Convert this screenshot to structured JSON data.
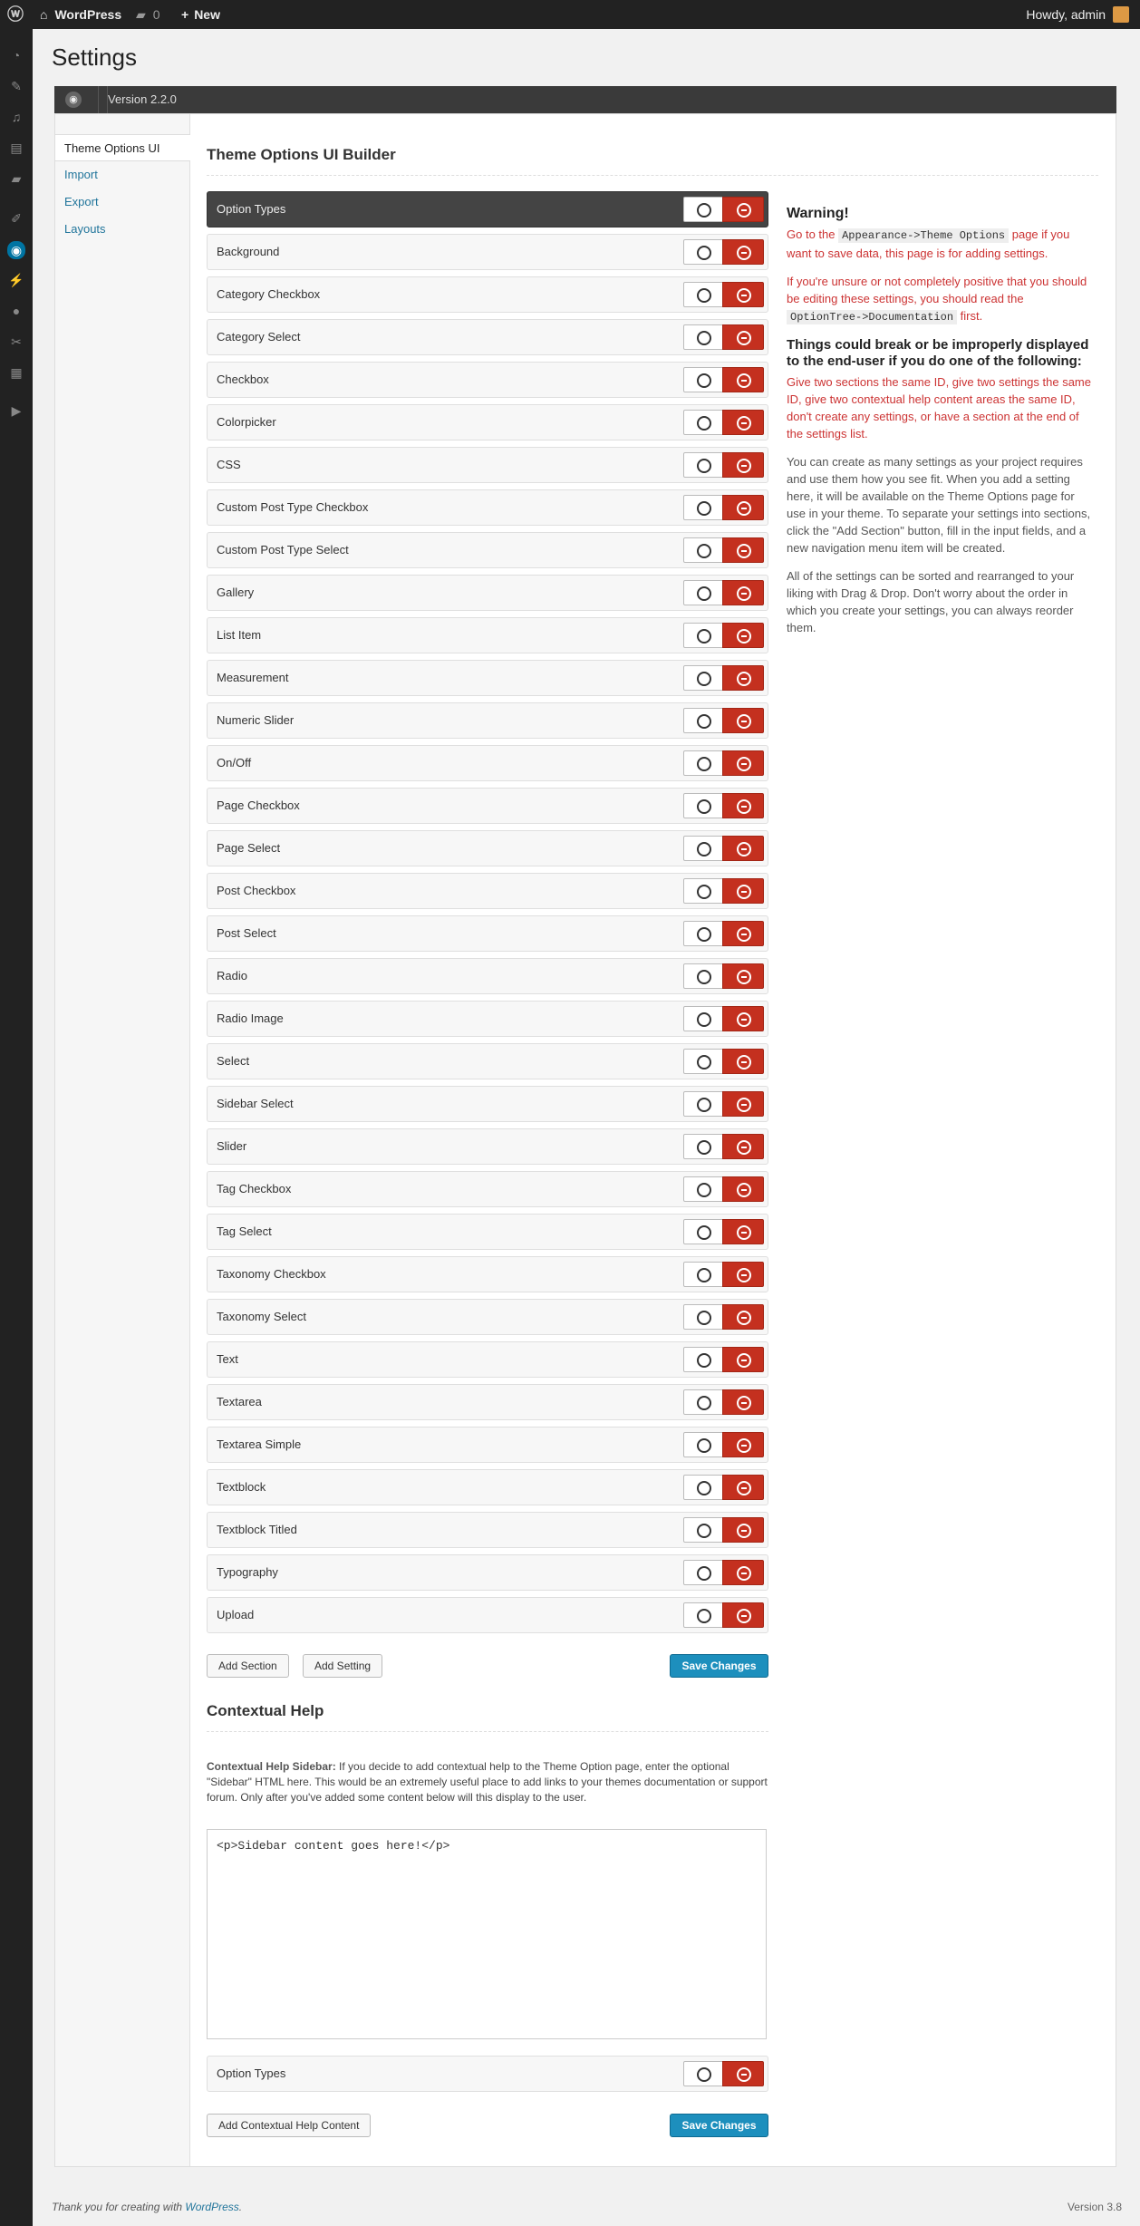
{
  "adminbar": {
    "site_name": "WordPress",
    "comments_count": "0",
    "new_label": "New",
    "howdy": "Howdy, admin"
  },
  "page": {
    "title": "Settings",
    "version": "Version 2.2.0"
  },
  "tabs": [
    "Theme Options UI",
    "Import",
    "Export",
    "Layouts"
  ],
  "builder": {
    "heading": "Theme Options UI Builder",
    "rows": [
      "Option Types",
      "Background",
      "Category Checkbox",
      "Category Select",
      "Checkbox",
      "Colorpicker",
      "CSS",
      "Custom Post Type Checkbox",
      "Custom Post Type Select",
      "Gallery",
      "List Item",
      "Measurement",
      "Numeric Slider",
      "On/Off",
      "Page Checkbox",
      "Page Select",
      "Post Checkbox",
      "Post Select",
      "Radio",
      "Radio Image",
      "Select",
      "Sidebar Select",
      "Slider",
      "Tag Checkbox",
      "Tag Select",
      "Taxonomy Checkbox",
      "Taxonomy Select",
      "Text",
      "Textarea",
      "Textarea Simple",
      "Textblock",
      "Textblock Titled",
      "Typography",
      "Upload"
    ],
    "add_section": "Add Section",
    "add_setting": "Add Setting",
    "save_changes": "Save Changes"
  },
  "help": {
    "warning_title": "Warning!",
    "p1_before": "Go to the ",
    "p1_code": "Appearance->Theme Options",
    "p1_after": " page if you want to save data, this page is for adding settings.",
    "p2_before": "If you're unsure or not completely positive that you should be editing these settings, you should read the ",
    "p2_code": "OptionTree->Documentation",
    "p2_after": " first.",
    "break_title": "Things could break or be improperly displayed to the end-user if you do one of the following:",
    "p3": "Give two sections the same ID, give two settings the same ID, give two contextual help content areas the same ID, don't create any settings, or have a section at the end of the settings list.",
    "p4": "You can create as many settings as your project requires and use them how you see fit. When you add a setting here, it will be available on the Theme Options page for use in your theme. To separate your settings into sections, click the \"Add Section\" button, fill in the input fields, and a new navigation menu item will be created.",
    "p5": "All of the settings can be sorted and rearranged to your liking with Drag & Drop. Don't worry about the order in which you create your settings, you can always reorder them."
  },
  "contextual": {
    "heading": "Contextual Help",
    "desc_label": "Contextual Help Sidebar:",
    "desc_text": " If you decide to add contextual help to the Theme Option page, enter the optional \"Sidebar\" HTML here. This would be an extremely useful place to add links to your themes documentation or support forum. Only after you've added some content below will this display to the user.",
    "sidebar_value": "<p>Sidebar content goes here!</p>",
    "row_label": "Option Types",
    "add_button": "Add Contextual Help Content",
    "save_changes": "Save Changes"
  },
  "footer": {
    "thanks_prefix": "Thank you for creating with ",
    "thanks_link": "WordPress",
    "thanks_suffix": ".",
    "version": "Version 3.8"
  },
  "colors": {
    "accent": "#0074a2",
    "delete": "#c4301f",
    "save": "#1d8fbd",
    "warning_text": "#cc3333"
  },
  "icons": [
    "wordpress-logo-icon",
    "home-icon",
    "comment-icon",
    "plus-icon",
    "dashboard-icon",
    "pin-icon",
    "media-icon",
    "pages-icon",
    "comments-menu-icon",
    "appearance-icon",
    "optiontree-icon",
    "plugins-icon",
    "users-icon",
    "tools-icon",
    "settings-icon",
    "collapse-icon",
    "edit-icon",
    "delete-icon"
  ]
}
